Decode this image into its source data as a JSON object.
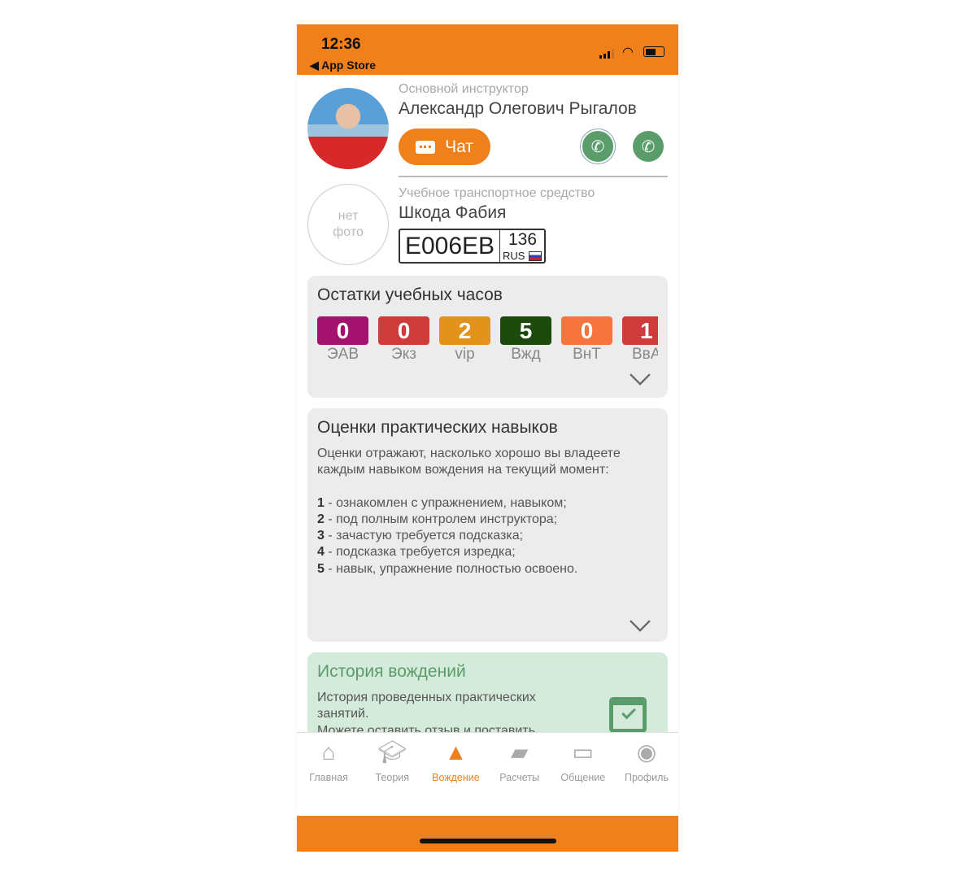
{
  "status_bar": {
    "time": "12:36",
    "back": "◀ App Store"
  },
  "instructor": {
    "label": "Основной инструктор",
    "name": "Александр Олегович Рыгалов",
    "chat_label": "Чат"
  },
  "vehicle": {
    "label": "Учебное транспортное средство",
    "name": "Шкода Фабия",
    "no_photo": [
      "нет",
      "фото"
    ],
    "plate_number": "E006EB",
    "plate_region": "136",
    "plate_country": "RUS"
  },
  "hours": {
    "title": "Остатки учебных часов",
    "items": [
      {
        "value": "0",
        "label": "ЭАВ",
        "color": "#a3136e"
      },
      {
        "value": "0",
        "label": "Экз",
        "color": "#cf3b3b"
      },
      {
        "value": "2",
        "label": "vip",
        "color": "#e3921b"
      },
      {
        "value": "5",
        "label": "Вжд",
        "color": "#1c4a0c"
      },
      {
        "value": "0",
        "label": "ВнТ",
        "color": "#f7743f"
      },
      {
        "value": "1",
        "label": "ВвА",
        "color": "#cf3b3b"
      }
    ]
  },
  "skills": {
    "title": "Оценки практических навыков",
    "intro": "Оценки отражают, насколько хорошо вы владеете каждым навыком вождения на текущий момент:",
    "levels": [
      {
        "n": "1",
        "text": " - ознакомлен с упражнением, навыком;"
      },
      {
        "n": "2",
        "text": " - под полным контролем инструктора;"
      },
      {
        "n": "3",
        "text": " - зачастую требуется подсказка;"
      },
      {
        "n": "4",
        "text": " - подсказка требуется изредка;"
      },
      {
        "n": "5",
        "text": " - навык, упражнение полностью освоено."
      }
    ]
  },
  "history": {
    "title": "История вождений",
    "text1": "История проведенных практических занятий.",
    "text2": "Можете оставить отзыв и поставить"
  },
  "tabs": [
    {
      "label": "Главная",
      "icon": "home-icon"
    },
    {
      "label": "Теория",
      "icon": "graduation-cap-icon"
    },
    {
      "label": "Вождение",
      "icon": "road-icon",
      "active": true
    },
    {
      "label": "Расчеты",
      "icon": "wallet-icon"
    },
    {
      "label": "Общение",
      "icon": "chat-icon"
    },
    {
      "label": "Профиль",
      "icon": "profile-icon"
    }
  ],
  "colors": {
    "accent": "#ef801c",
    "green": "#5a9c6a",
    "history_bg": "#d4eadb"
  }
}
